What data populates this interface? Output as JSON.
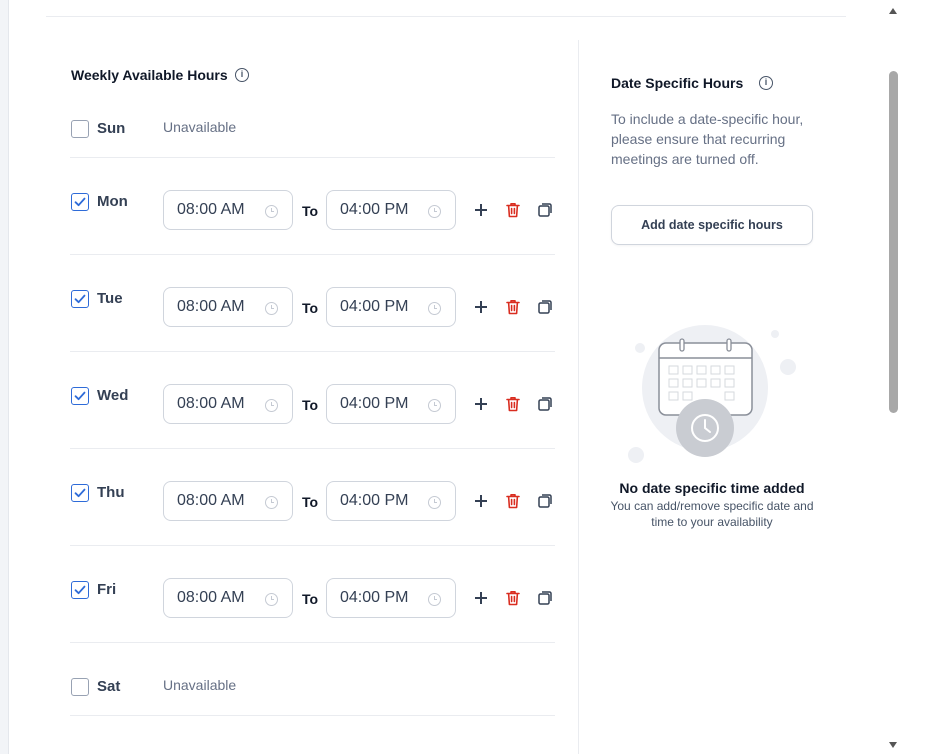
{
  "weekly": {
    "title": "Weekly Available Hours",
    "info_icon": "info-circle-icon",
    "to_label": "To",
    "unavailable_label": "Unavailable",
    "days": [
      {
        "label": "Sun",
        "checked": false,
        "start": "",
        "end": ""
      },
      {
        "label": "Mon",
        "checked": true,
        "start": "08:00 AM",
        "end": "04:00 PM"
      },
      {
        "label": "Tue",
        "checked": true,
        "start": "08:00 AM",
        "end": "04:00 PM"
      },
      {
        "label": "Wed",
        "checked": true,
        "start": "08:00 AM",
        "end": "04:00 PM"
      },
      {
        "label": "Thu",
        "checked": true,
        "start": "08:00 AM",
        "end": "04:00 PM"
      },
      {
        "label": "Fri",
        "checked": true,
        "start": "08:00 AM",
        "end": "04:00 PM"
      },
      {
        "label": "Sat",
        "checked": false,
        "start": "",
        "end": ""
      }
    ],
    "row_actions": {
      "add": "plus-icon",
      "delete": "trash-icon",
      "copy": "copy-icon"
    }
  },
  "date_specific": {
    "title": "Date Specific Hours",
    "description": "To include a date-specific hour, please ensure that recurring meetings are turned off.",
    "add_button": "Add date specific hours",
    "empty_illustration": "calendar-clock-icon",
    "empty_title": "No date specific time added",
    "empty_subtitle": "You can add/remove specific date and time to your availability"
  },
  "colors": {
    "accent": "#2e6bd8",
    "danger": "#d92d20",
    "text_primary": "#101828",
    "text_muted": "#667085",
    "border": "#d0d5dd"
  }
}
